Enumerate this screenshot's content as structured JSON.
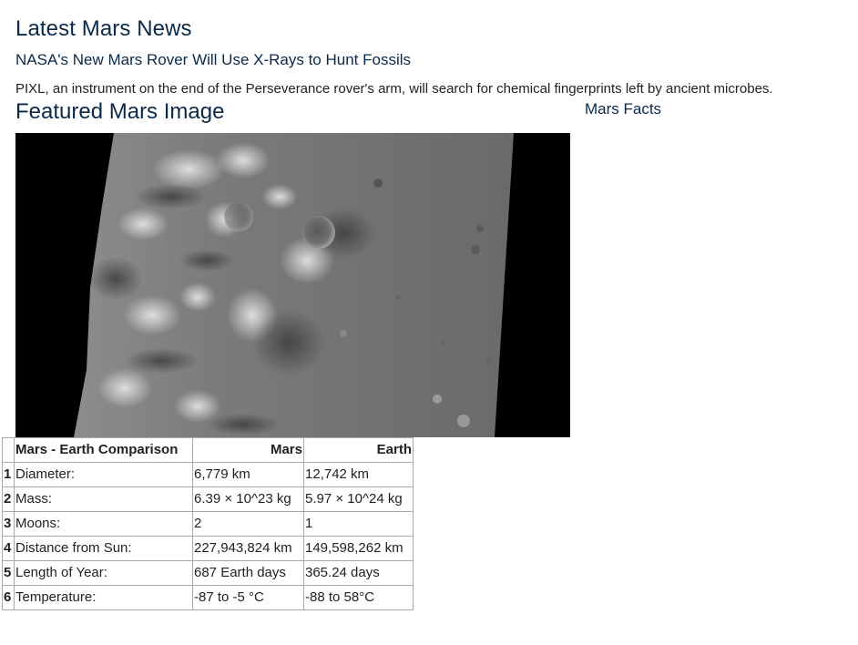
{
  "news": {
    "heading": "Latest Mars News",
    "title": "NASA's New Mars Rover Will Use X-Rays to Hunt Fossils",
    "teaser": "PIXL, an instrument on the end of the Perseverance rover's arm, will search for chemical fingerprints left by ancient microbes."
  },
  "featured": {
    "heading": "Featured Mars Image"
  },
  "facts": {
    "heading": "Mars Facts",
    "table": {
      "columns": [
        "Mars - Earth Comparison",
        "Mars",
        "Earth"
      ],
      "rows": [
        {
          "index": "1",
          "description": "Diameter:",
          "mars": "6,779 km",
          "earth": "12,742 km"
        },
        {
          "index": "2",
          "description": "Mass:",
          "mars": "6.39 × 10^23 kg",
          "earth": "5.97 × 10^24 kg"
        },
        {
          "index": "3",
          "description": "Moons:",
          "mars": "2",
          "earth": "1"
        },
        {
          "index": "4",
          "description": "Distance from Sun:",
          "mars": "227,943,824 km",
          "earth": "149,598,262 km"
        },
        {
          "index": "5",
          "description": "Length of Year:",
          "mars": "687 Earth days",
          "earth": "365.24 days"
        },
        {
          "index": "6",
          "description": "Temperature:",
          "mars": "-87 to -5 °C",
          "earth": "-88 to 58°C"
        }
      ]
    }
  },
  "colors": {
    "heading": "#0b2a4a",
    "table_border": "#aaaaaa"
  }
}
